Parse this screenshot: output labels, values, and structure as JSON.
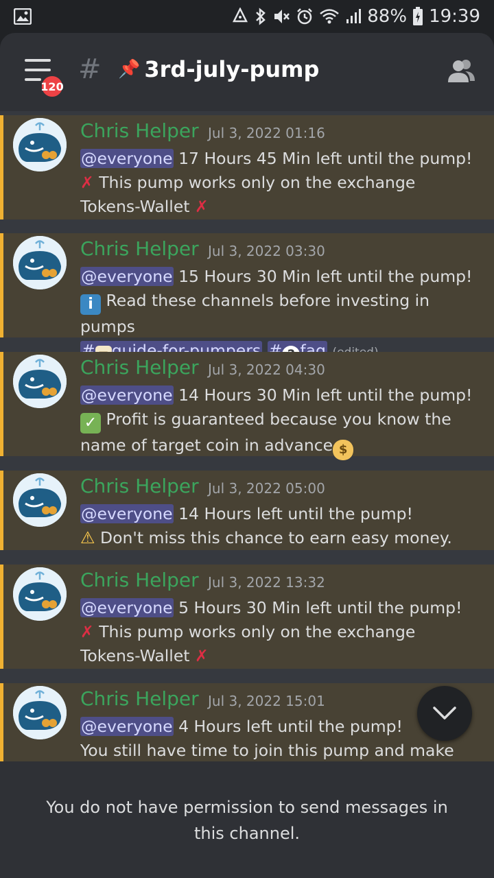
{
  "status_bar": {
    "battery": "88%",
    "time": "19:39",
    "icons": [
      "gallery-icon",
      "sync-icon",
      "bluetooth-icon",
      "mute-icon",
      "alarm-icon",
      "wifi-icon",
      "signal-icon",
      "battery-icon"
    ]
  },
  "header": {
    "badge_count": "120",
    "channel_emoji": "📌",
    "channel_name": "3rd-july-pump"
  },
  "messages": [
    {
      "author": "Chris Helper",
      "time": "Jul 3, 2022 01:16",
      "mention": "@everyone",
      "line1": " 17 Hours 45 Min left until the pump!",
      "line2": "This pump works only on the exchange",
      "line3": "Tokens-Wallet"
    },
    {
      "author": "Chris Helper",
      "time": "Jul 3, 2022 03:30",
      "mention": "@everyone",
      "line1": " 15 Hours 30 Min left until the pump!",
      "line2": "Read these channels before investing in pumps",
      "channel1": "guide-for-pumpers",
      "channel2": "faq",
      "edited": "(edited)"
    },
    {
      "author": "Chris Helper",
      "time": "Jul 3, 2022 04:30",
      "mention": "@everyone",
      "line1": " 14 Hours 30 Min left until the pump!",
      "line2": "Profit is guaranteed because you know the",
      "line3": "name of target coin in advance"
    },
    {
      "author": "Chris Helper",
      "time": "Jul 3, 2022 05:00",
      "mention": "@everyone",
      "line1": " 14 Hours left until the pump!",
      "line2": "Don't miss this chance to earn easy money."
    },
    {
      "author": "Chris Helper",
      "time": "Jul 3, 2022 13:32",
      "mention": "@everyone",
      "line1": " 5 Hours 30 Min left until the pump!",
      "line2": "This pump works only on the exchange",
      "line3": "Tokens-Wallet"
    },
    {
      "author": "Chris Helper",
      "time": "Jul 3, 2022 15:01",
      "mention": "@everyone",
      "line1": " 4 Hours left until the pump!",
      "line2": "You still have time to join this pump and make"
    }
  ],
  "footer": {
    "notice": "You do not have permission to send messages in this channel."
  }
}
